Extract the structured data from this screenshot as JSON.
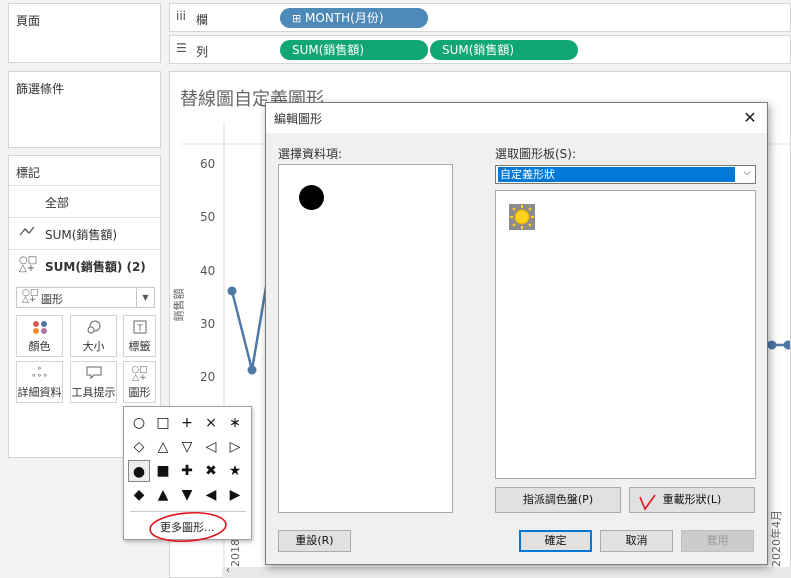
{
  "left_panes": {
    "pages_title": "頁面",
    "filters_title": "篩選條件",
    "marks_title": "標記",
    "marks_rows": [
      "全部",
      "SUM(銷售額)",
      "SUM(銷售額) (2)"
    ],
    "mark_type": "圖形",
    "cards": [
      {
        "label": "顏色",
        "icon": "color-dots-icon"
      },
      {
        "label": "大小",
        "icon": "size-icon"
      },
      {
        "label": "標籤",
        "icon": "label-T-icon"
      },
      {
        "label": "詳細資料",
        "icon": "detail-dots-icon"
      },
      {
        "label": "工具提示",
        "icon": "tooltip-icon"
      },
      {
        "label": "圖形",
        "icon": "shape-icon"
      }
    ]
  },
  "shelves": {
    "columns_label": "欄",
    "rows_label": "列",
    "columns_pill": "MONTH(月份)",
    "rows_pills": [
      "SUM(銷售額)",
      "SUM(銷售額)"
    ]
  },
  "view": {
    "title": "替線圖自定義圖形",
    "ylabel": "銷售額",
    "yticks": [
      "60",
      "50",
      "40",
      "30",
      "20"
    ],
    "xticks": [
      "2018年2月",
      "2020年4月"
    ]
  },
  "shape_popup": {
    "shapes": [
      "○",
      "□",
      "+",
      "×",
      "∗",
      "◇",
      "△",
      "▽",
      "◁",
      "▷",
      "●",
      "■",
      "✚",
      "✖",
      "★",
      "◆",
      "▲",
      "▼",
      "◀",
      "▶"
    ],
    "more_label": "更多圖形..."
  },
  "dialog": {
    "title": "編輯圖形",
    "close": "✕",
    "select_data_label": "選擇資料項:",
    "select_palette_label": "選取圖形板(S):",
    "palette_value": "自定義形狀",
    "assign_btn": "指派調色盤(P)",
    "reload_btn": "重載形狀(L)",
    "reset_btn": "重設(R)",
    "ok_btn": "確定",
    "cancel_btn": "取消",
    "apply_btn": "套用"
  },
  "colors": {
    "line": "#4e79a7",
    "pill_blue": "#4e8ab8",
    "pill_green": "#11a774",
    "accent": "#0078d7",
    "annotation": "#e0141e"
  }
}
